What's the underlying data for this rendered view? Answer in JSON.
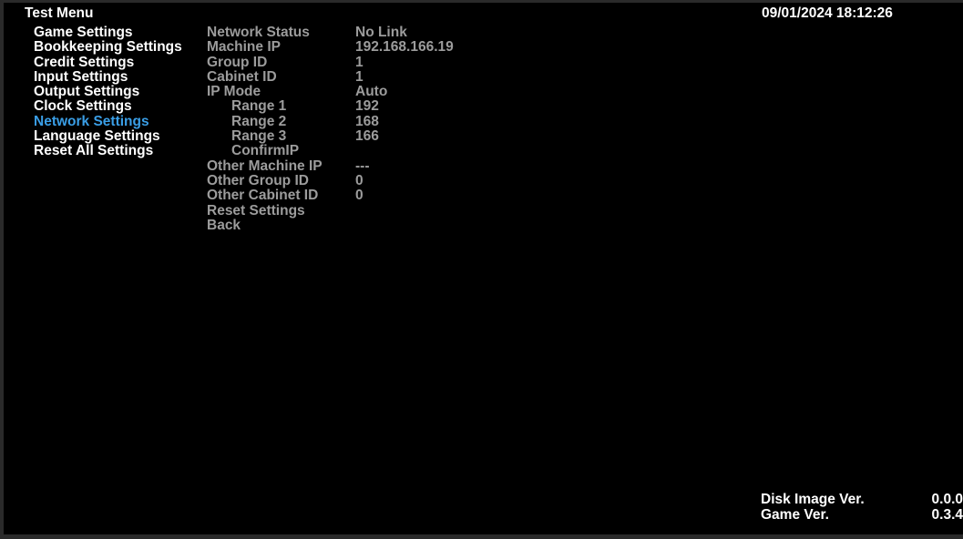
{
  "header": {
    "title": "Test Menu",
    "datetime": "09/01/2024 18:12:26"
  },
  "menu": {
    "active_color": "#3a9ee6",
    "items": [
      {
        "label": "Game Settings"
      },
      {
        "label": "Bookkeeping Settings"
      },
      {
        "label": "Credit Settings"
      },
      {
        "label": "Input Settings"
      },
      {
        "label": "Output Settings"
      },
      {
        "label": "Clock Settings"
      },
      {
        "label": "Network Settings",
        "selected": true
      },
      {
        "label": "Language Settings"
      },
      {
        "label": "Reset All Settings"
      }
    ]
  },
  "network": {
    "rows": [
      {
        "label": "Network Status",
        "value": "No Link"
      },
      {
        "label": "Machine IP",
        "value": "192.168.166.19"
      },
      {
        "label": "Group ID",
        "value": "1"
      },
      {
        "label": "Cabinet ID",
        "value": "1"
      },
      {
        "label": "IP Mode",
        "value": "Auto"
      },
      {
        "label": "Range 1",
        "value": "192"
      },
      {
        "label": "Range 2",
        "value": "168"
      },
      {
        "label": "Range 3",
        "value": "166"
      },
      {
        "label": "ConfirmIP",
        "value": ""
      },
      {
        "label": "Other Machine IP",
        "value": "---"
      },
      {
        "label": "Other Group ID",
        "value": "0"
      },
      {
        "label": "Other Cabinet ID",
        "value": "0"
      },
      {
        "label": "Reset Settings",
        "value": ""
      },
      {
        "label": "Back",
        "value": ""
      }
    ]
  },
  "footer": {
    "disk_image_label": "Disk Image Ver.",
    "disk_image_value": "0.0.0",
    "game_label": "Game Ver.",
    "game_value": "0.3.4"
  }
}
